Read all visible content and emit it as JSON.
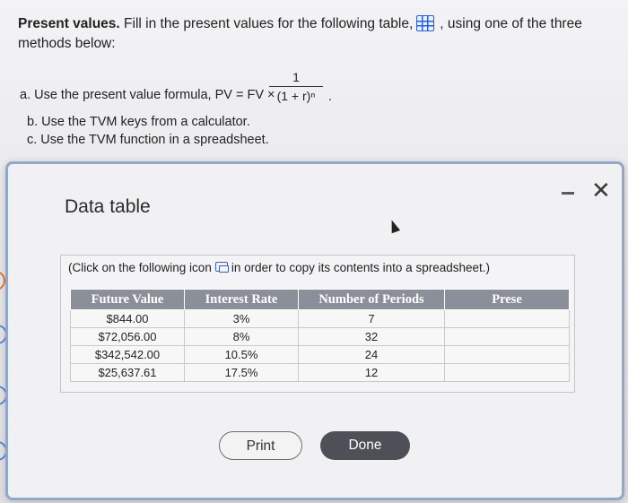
{
  "question": {
    "title_bold": "Present values.",
    "title_rest": "Fill in the present values for the following table,",
    "title_after_icon": ", using one of the three methods below:",
    "method_a_prefix": "a. Use the present value formula, PV = FV ×",
    "fraction_numerator": "1",
    "fraction_denominator": "(1 + r)ⁿ",
    "method_a_suffix": ".",
    "method_b": "b. Use the TVM keys from a calculator.",
    "method_c": "c. Use the TVM function in a spreadsheet."
  },
  "icons": {
    "table": "table-grid-icon",
    "copy": "copy-icon",
    "minimize": "minimize-icon",
    "close": "close-icon",
    "close_glyph": "✕",
    "cursor": "mouse-cursor-icon"
  },
  "modal": {
    "title": "Data table",
    "copy_note_before": "(Click on the following icon",
    "copy_note_after": "in order to copy its contents into a spreadsheet.)",
    "columns": [
      "Future Value",
      "Interest Rate",
      "Number of Periods",
      "Prese"
    ],
    "rows": [
      [
        "$844.00",
        "3%",
        "7",
        ""
      ],
      [
        "$72,056.00",
        "8%",
        "32",
        ""
      ],
      [
        "$342,542.00",
        "10.5%",
        "24",
        ""
      ],
      [
        "$25,637.61",
        "17.5%",
        "12",
        ""
      ]
    ],
    "print_label": "Print",
    "done_label": "Done"
  },
  "colors": {
    "accent_blue": "#2a5fd0",
    "header_gray": "#8a8f9a",
    "done_button": "#4d5056",
    "modal_border": "#93a7c6"
  }
}
